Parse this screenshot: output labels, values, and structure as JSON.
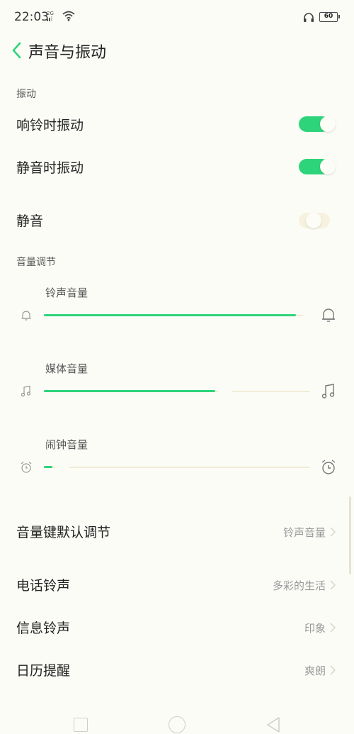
{
  "status_bar": {
    "time": "22:03",
    "network": "2G",
    "battery": "60",
    "icons": [
      "signal-icon",
      "wifi-icon",
      "headset-icon",
      "battery-icon"
    ]
  },
  "header": {
    "title": "声音与振动",
    "back_icon": "chevron-left-icon"
  },
  "vibration": {
    "section_label": "振动",
    "ring_vibrate": {
      "label": "响铃时振动",
      "on": true
    },
    "silent_vibrate": {
      "label": "静音时振动",
      "on": true
    }
  },
  "silent": {
    "label": "静音",
    "on": false
  },
  "volume": {
    "section_label": "音量调节",
    "ringtone": {
      "label": "铃声音量",
      "level": 1.0,
      "icon": "bell-icon"
    },
    "media": {
      "label": "媒体音量",
      "level": 0.67,
      "icon": "music-note-icon"
    },
    "alarm": {
      "label": "闹钟音量",
      "level": 0.03,
      "icon": "alarm-clock-icon"
    }
  },
  "settings": {
    "volume_key": {
      "label": "音量键默认调节",
      "value": "铃声音量"
    },
    "phone_ringtone": {
      "label": "电话铃声",
      "value": "多彩的生活"
    },
    "message_ringtone": {
      "label": "信息铃声",
      "value": "印象"
    },
    "calendar_reminder": {
      "label": "日历提醒",
      "value": "爽朗"
    }
  },
  "colors": {
    "accent": "#2ed47a",
    "background": "#fcfcf7",
    "secondary_text": "#999999"
  }
}
